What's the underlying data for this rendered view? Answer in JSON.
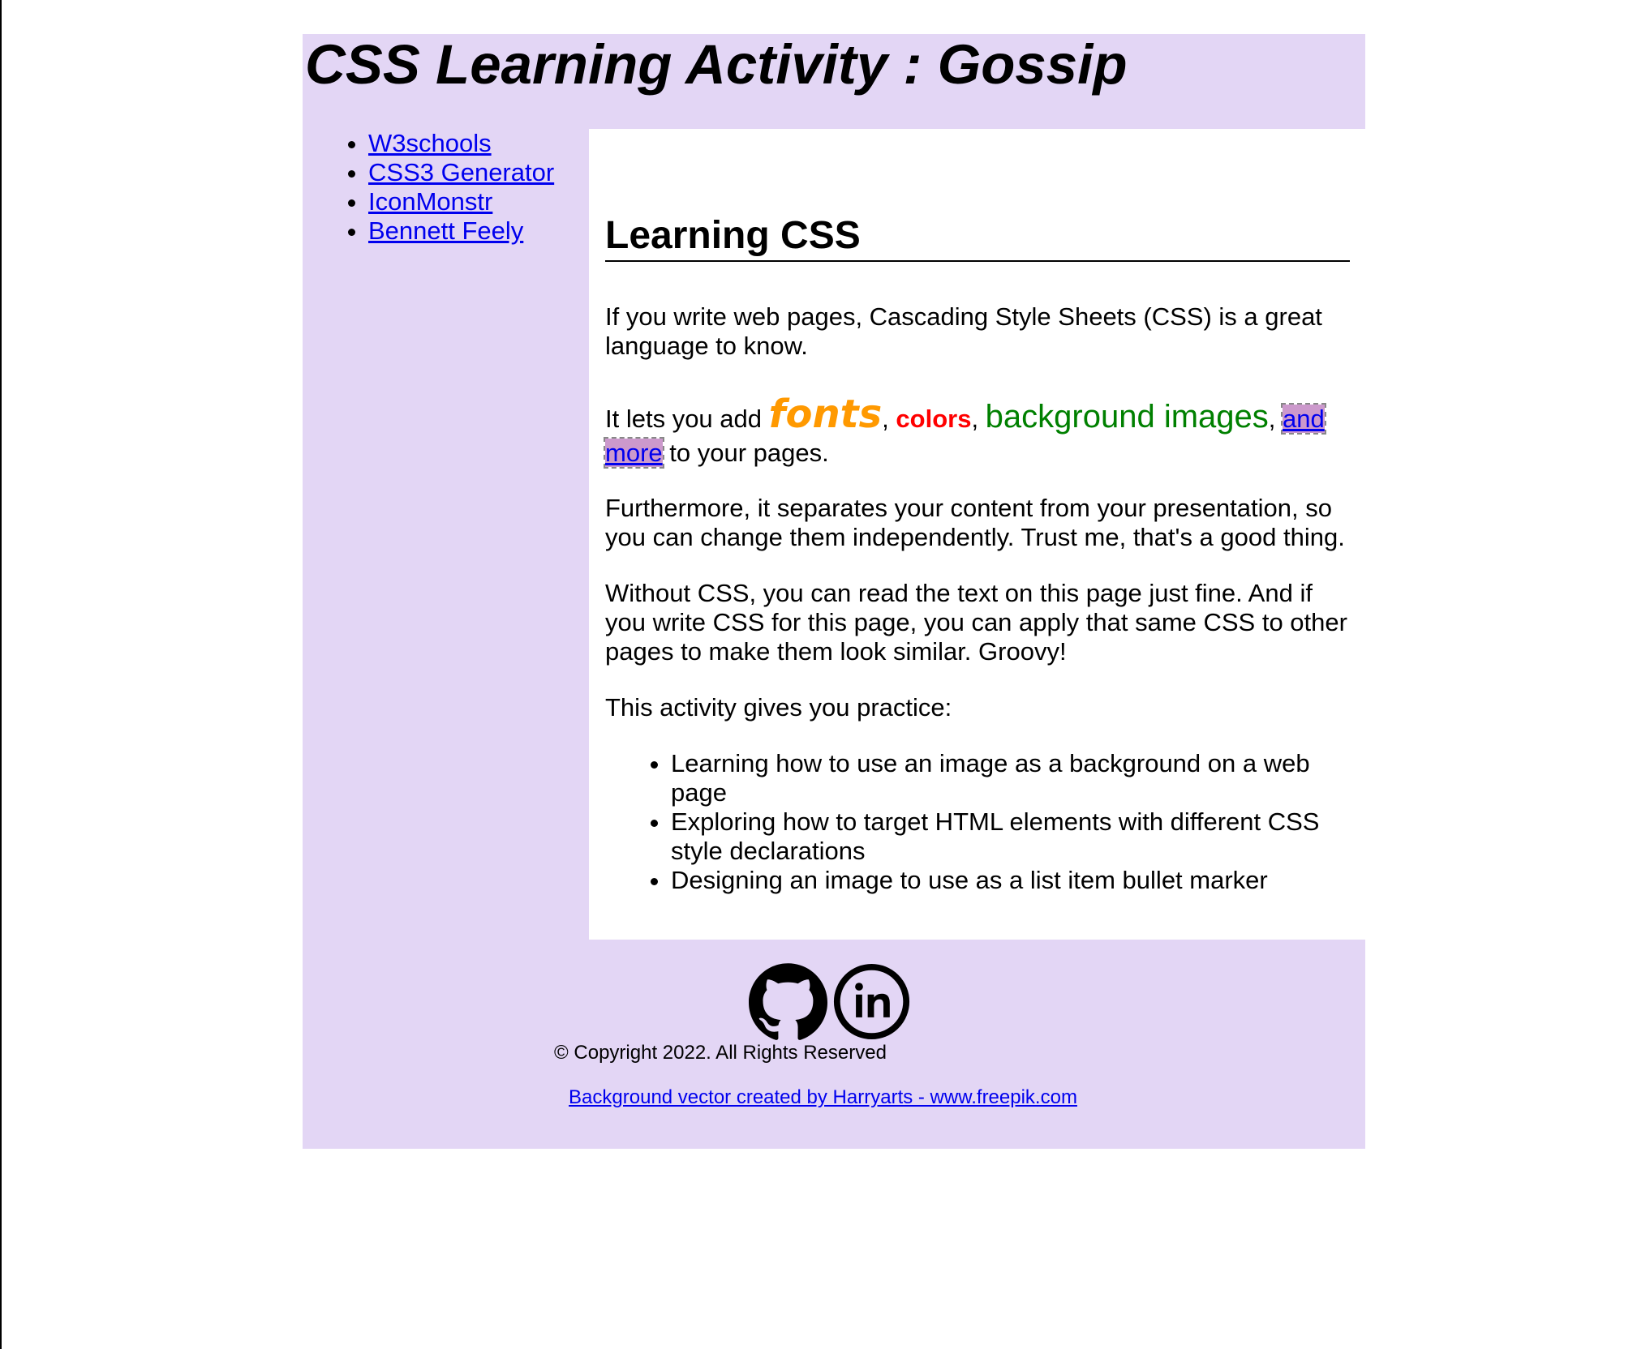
{
  "header": {
    "title": "CSS Learning Activity : Gossip"
  },
  "sidebar": {
    "links": [
      {
        "label": "W3schools"
      },
      {
        "label": "CSS3 Generator"
      },
      {
        "label": "IconMonstr"
      },
      {
        "label": "Bennett Feely"
      }
    ]
  },
  "main": {
    "heading": "Learning CSS",
    "intro": "If you write web pages, Cascading Style Sheets (CSS) is a great language to know.",
    "features": {
      "prefix": "It lets you add ",
      "fonts": "fonts",
      "sep1": ", ",
      "colors": "colors",
      "sep2": ", ",
      "background_images": "background images",
      "sep3": ", ",
      "and_more": "and more",
      "suffix": " to your pages."
    },
    "separate": "Furthermore, it separates your content from your presentation, so you can change them independently. Trust me, that's a good thing.",
    "without_css": "Without CSS, you can read the text on this page just fine. And if you write CSS for this page, you can apply that same CSS to other pages to make them look similar. Groovy!",
    "activity_intro": "This activity gives you practice:",
    "practice_items": [
      "Learning how to use an image as a background on a web page",
      "Exploring how to target HTML elements with different CSS style declarations",
      "Designing an image to use as a list item bullet marker"
    ]
  },
  "footer": {
    "social_icons": [
      "github-icon",
      "linkedin-icon"
    ],
    "copyright": "© Copyright 2022. All Rights Reserved",
    "credit_link": "Background vector created by Harryarts - www.freepik.com"
  },
  "colors": {
    "panel_background": "#e3d6f5",
    "link": "#0000ee",
    "fonts_word": "#ff9900",
    "colors_word": "#ff0000",
    "background_images_word": "#008000",
    "and_more_highlight": "#cc99cc"
  }
}
